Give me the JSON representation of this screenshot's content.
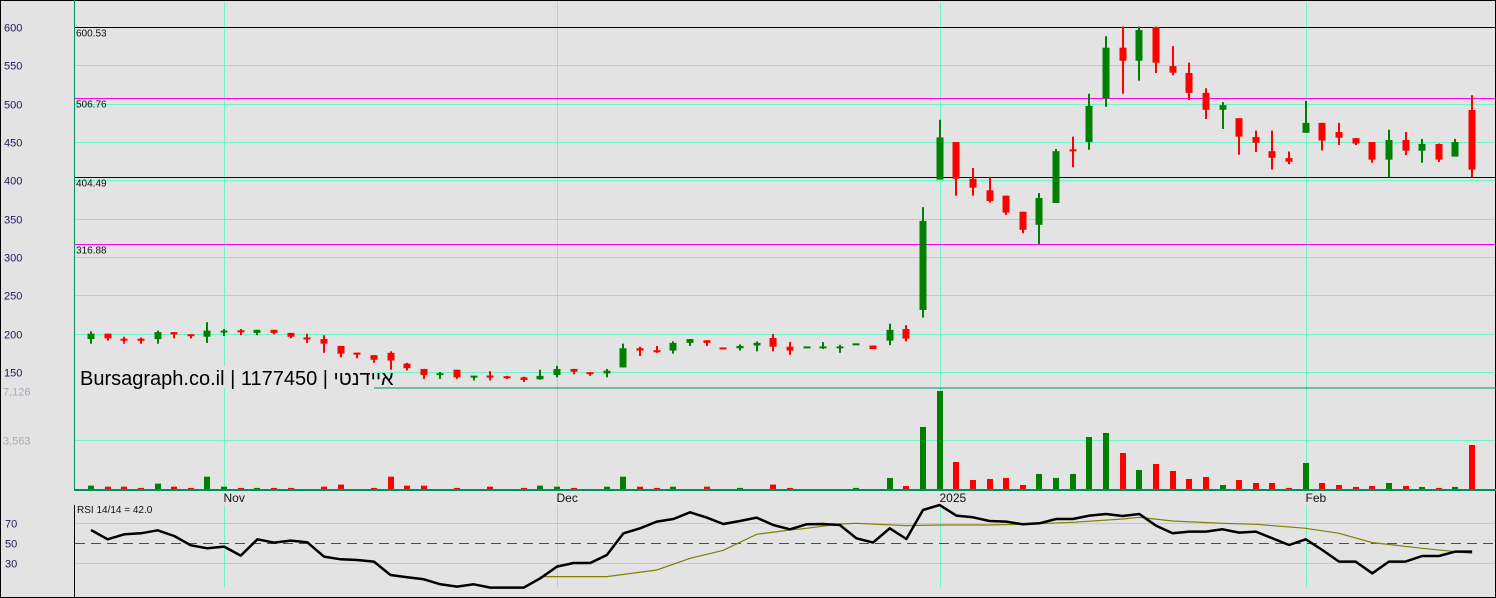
{
  "chart_data": {
    "type": "candlestick",
    "title": "Bursagraph.co.il | 1177450 | איידנטי",
    "price_axis": {
      "range": [
        129,
        635
      ],
      "ticks": [
        600,
        550,
        500,
        450,
        400,
        350,
        300,
        250,
        200,
        150
      ]
    },
    "x_labels": [
      {
        "label": "Nov",
        "index": 8
      },
      {
        "label": "Dec",
        "index": 28
      },
      {
        "label": "2025",
        "index": 51
      },
      {
        "label": "Feb",
        "index": 73
      }
    ],
    "levels": [
      {
        "value": 600.53,
        "label": "600.53",
        "color": "#000000"
      },
      {
        "value": 506.76,
        "label": "506.76",
        "color": "#ff00ff"
      },
      {
        "value": 404.49,
        "label": "404.49",
        "color": "#000060"
      },
      {
        "value": 316.88,
        "label": "316.88",
        "color": "#ff00ff"
      }
    ],
    "colors": {
      "up": "#008000",
      "down": "#ff0000",
      "grid": "#70f5c8",
      "rsi": "#000000",
      "signal": "#808000",
      "midline": "#ff0000"
    },
    "candles_ohlc": [
      [
        193,
        203,
        187,
        200
      ],
      [
        200,
        200,
        191,
        194
      ],
      [
        192.2,
        196,
        187,
        192
      ],
      [
        192.2,
        195,
        187,
        192
      ],
      [
        193,
        204,
        187,
        202
      ],
      [
        202,
        202,
        194,
        199
      ],
      [
        199,
        199,
        194,
        197
      ],
      [
        196,
        215,
        188,
        204
      ],
      [
        202.5,
        206,
        197,
        203
      ],
      [
        203.2,
        206,
        198,
        203
      ],
      [
        201,
        205,
        198,
        205
      ],
      [
        205,
        205,
        199,
        201
      ],
      [
        201,
        201,
        194,
        196
      ],
      [
        194,
        200,
        188,
        193.5
      ],
      [
        193,
        198,
        175,
        187
      ],
      [
        184,
        184,
        169,
        174
      ],
      [
        175,
        175,
        168,
        173
      ],
      [
        172,
        172,
        162,
        166
      ],
      [
        175,
        177,
        153,
        165
      ],
      [
        161,
        162,
        152,
        155
      ],
      [
        154,
        154,
        141,
        146
      ],
      [
        147,
        150,
        141,
        147.5
      ],
      [
        153,
        153,
        141,
        143
      ],
      [
        143,
        145,
        139,
        145
      ],
      [
        144.2,
        151,
        139,
        144
      ],
      [
        143.2,
        145,
        141,
        143
      ],
      [
        143,
        144,
        137,
        139.6
      ],
      [
        140.5,
        153,
        140,
        145
      ],
      [
        146,
        158,
        143,
        154
      ],
      [
        154,
        154,
        147,
        150.4
      ],
      [
        149,
        149,
        145,
        148
      ],
      [
        148.3,
        154,
        143,
        151.7
      ],
      [
        156,
        187,
        156,
        181
      ],
      [
        181,
        183,
        171,
        178
      ],
      [
        177.2,
        184,
        175,
        177
      ],
      [
        178,
        190,
        174,
        188
      ],
      [
        188,
        193,
        184,
        193
      ],
      [
        191.4,
        191.4,
        184,
        188
      ],
      [
        181,
        181,
        180.5,
        180.5
      ],
      [
        181,
        186,
        178,
        184
      ],
      [
        184.6,
        190,
        177,
        188
      ],
      [
        194.4,
        199.6,
        177,
        183
      ],
      [
        183,
        189,
        172.5,
        178
      ],
      [
        182,
        182.2,
        182,
        182.2
      ],
      [
        182,
        189,
        180,
        182.2
      ],
      [
        182,
        185.5,
        175,
        182.2
      ],
      [
        186,
        186.2,
        186,
        186.2
      ],
      [
        184.5,
        184.5,
        180,
        180
      ],
      [
        191,
        213,
        185,
        205
      ],
      [
        206,
        211,
        190,
        193.5
      ],
      [
        231,
        365,
        221,
        347
      ],
      [
        401,
        479,
        401,
        456
      ],
      [
        450,
        450,
        380,
        402
      ],
      [
        402,
        416,
        380,
        390.5
      ],
      [
        387,
        404.5,
        371,
        373
      ],
      [
        380,
        380,
        355,
        358
      ],
      [
        359,
        359,
        331,
        335.5
      ],
      [
        342,
        383.5,
        317,
        377
      ],
      [
        370.5,
        441,
        370.5,
        438
      ],
      [
        439.2,
        457,
        417,
        439
      ],
      [
        450,
        513,
        440,
        497
      ],
      [
        507,
        588,
        496,
        573
      ],
      [
        573,
        600.5,
        513,
        556
      ],
      [
        556,
        600.5,
        530,
        596
      ],
      [
        600,
        600.5,
        540,
        553.5
      ],
      [
        549,
        575,
        537,
        540.4
      ],
      [
        540,
        553.6,
        505,
        514
      ],
      [
        514,
        520,
        480,
        492
      ],
      [
        492,
        502,
        467,
        498
      ],
      [
        481,
        481,
        433.5,
        457
      ],
      [
        456.5,
        465,
        437,
        449
      ],
      [
        438,
        465,
        414,
        429.5
      ],
      [
        429,
        437.5,
        421,
        424.3
      ],
      [
        462,
        503.5,
        462,
        475
      ],
      [
        475,
        475,
        439,
        452
      ],
      [
        463,
        475,
        446,
        455.6
      ],
      [
        455,
        455,
        446,
        448
      ],
      [
        450,
        450,
        423,
        427
      ],
      [
        427,
        466,
        404,
        452.6
      ],
      [
        452.6,
        463,
        433,
        438.7
      ],
      [
        438.7,
        454,
        423,
        447.4
      ],
      [
        447.4,
        448,
        424,
        427
      ],
      [
        431,
        454,
        431,
        450
      ],
      [
        491.7,
        511,
        404,
        414
      ]
    ],
    "volume": {
      "range": [
        0,
        7321
      ],
      "ticks": [
        {
          "value": 7126,
          "label": "7,126"
        },
        {
          "value": 3563,
          "label": "3,563"
        }
      ],
      "values": [
        265,
        190,
        190,
        100,
        410,
        190,
        100,
        915,
        190,
        100,
        100,
        100,
        100,
        0,
        190,
        340,
        0,
        100,
        915,
        265,
        265,
        0,
        100,
        0,
        190,
        0,
        100,
        265,
        190,
        100,
        0,
        190,
        915,
        190,
        100,
        190,
        0,
        190,
        0,
        100,
        0,
        340,
        100,
        0,
        0,
        0,
        100,
        0,
        820,
        240,
        4507,
        7110,
        1976,
        675,
        747,
        820,
        313,
        1109,
        820,
        1109,
        3784,
        4073,
        2627,
        1398,
        1832,
        1326,
        747,
        892,
        313,
        675,
        458,
        458,
        100,
        1904,
        458,
        313,
        170,
        240,
        458,
        240,
        170,
        100,
        170,
        3205
      ],
      "up_override": [
        59
      ]
    },
    "rsi": {
      "label": "RSI 14/14 = 42.0",
      "range": [
        -3,
        90
      ],
      "ticks": [
        70,
        50,
        30
      ],
      "values": [
        63.3,
        54,
        59,
        60,
        63,
        57.3,
        48,
        45,
        46.7,
        37.7,
        54,
        50.7,
        52.7,
        51,
        36.7,
        34,
        33.3,
        31.7,
        18.3,
        16,
        14,
        9,
        6.7,
        9,
        5.7,
        5.7,
        5.7,
        15,
        26.7,
        30.3,
        30.3,
        38.3,
        60,
        65,
        71.7,
        74.3,
        81,
        75.7,
        69.3,
        72.3,
        75.7,
        68.3,
        64,
        69,
        69.3,
        68.3,
        55,
        50.7,
        65,
        54.3,
        83.3,
        88.3,
        77.7,
        76,
        72.3,
        71.7,
        69,
        70,
        74.3,
        74.3,
        77.7,
        79.3,
        77.3,
        79.3,
        67.7,
        60,
        61.7,
        61.7,
        64,
        60.7,
        61.7,
        55,
        48.3,
        54,
        43.3,
        31.7,
        31.7,
        20,
        31.7,
        31.7,
        37.3,
        37.3,
        41.7,
        41.7
      ],
      "signal_points": [
        [
          27,
          16.7
        ],
        [
          31,
          16.7
        ],
        [
          34,
          23.3
        ],
        [
          36,
          35
        ],
        [
          38,
          43
        ],
        [
          40,
          59
        ],
        [
          42,
          63.3
        ],
        [
          43,
          65
        ],
        [
          45,
          69.3
        ],
        [
          46,
          70
        ],
        [
          49,
          67.7
        ],
        [
          51,
          68.3
        ],
        [
          54,
          68.3
        ],
        [
          56,
          69
        ],
        [
          59,
          71
        ],
        [
          62,
          74.3
        ],
        [
          63,
          76
        ],
        [
          65,
          72.3
        ],
        [
          68,
          70
        ],
        [
          70,
          69
        ],
        [
          73,
          65
        ],
        [
          75,
          60
        ],
        [
          77,
          50.7
        ],
        [
          80,
          45
        ],
        [
          83,
          40
        ]
      ]
    }
  }
}
